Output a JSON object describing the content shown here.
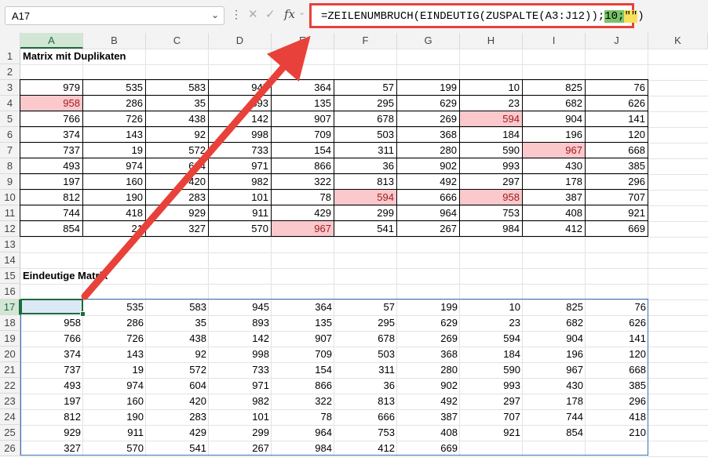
{
  "namebox": {
    "value": "A17"
  },
  "formula": {
    "part1": "=ZEILENUMBRUCH(EINDEUTIG(ZUSPALTE(A3:J12));",
    "part2": "10;",
    "part3": "\"\"",
    "part4": ")"
  },
  "columns": [
    "A",
    "B",
    "C",
    "D",
    "E",
    "F",
    "G",
    "H",
    "I",
    "J",
    "K"
  ],
  "rows": [
    "1",
    "2",
    "3",
    "4",
    "5",
    "6",
    "7",
    "8",
    "9",
    "10",
    "11",
    "12",
    "13",
    "14",
    "15",
    "16",
    "17",
    "18",
    "19",
    "20",
    "21",
    "22",
    "23",
    "24",
    "25",
    "26"
  ],
  "title1": "Matrix mit Duplikaten",
  "title2": "Eindeutige Matrix",
  "matrix1": [
    [
      979,
      535,
      583,
      945,
      364,
      57,
      199,
      10,
      825,
      76
    ],
    [
      958,
      286,
      35,
      893,
      135,
      295,
      629,
      23,
      682,
      626
    ],
    [
      766,
      726,
      438,
      142,
      907,
      678,
      269,
      594,
      904,
      141
    ],
    [
      374,
      143,
      92,
      998,
      709,
      503,
      368,
      184,
      196,
      120
    ],
    [
      737,
      19,
      572,
      733,
      154,
      311,
      280,
      590,
      967,
      668
    ],
    [
      493,
      974,
      604,
      971,
      866,
      36,
      902,
      993,
      430,
      385
    ],
    [
      197,
      160,
      420,
      982,
      322,
      813,
      492,
      297,
      178,
      296
    ],
    [
      812,
      190,
      283,
      101,
      78,
      594,
      666,
      958,
      387,
      707
    ],
    [
      744,
      418,
      929,
      911,
      429,
      299,
      964,
      753,
      408,
      921
    ],
    [
      854,
      21,
      327,
      570,
      967,
      541,
      267,
      984,
      412,
      669
    ]
  ],
  "matrix2": [
    [
      979,
      535,
      583,
      945,
      364,
      57,
      199,
      10,
      825,
      76
    ],
    [
      958,
      286,
      35,
      893,
      135,
      295,
      629,
      23,
      682,
      626
    ],
    [
      766,
      726,
      438,
      142,
      907,
      678,
      269,
      594,
      904,
      141
    ],
    [
      374,
      143,
      92,
      998,
      709,
      503,
      368,
      184,
      196,
      120
    ],
    [
      737,
      19,
      572,
      733,
      154,
      311,
      280,
      590,
      967,
      668
    ],
    [
      493,
      974,
      604,
      971,
      866,
      36,
      902,
      993,
      430,
      385
    ],
    [
      197,
      160,
      420,
      982,
      322,
      813,
      492,
      297,
      178,
      296
    ],
    [
      812,
      190,
      283,
      101,
      78,
      666,
      387,
      707,
      744,
      418
    ],
    [
      929,
      911,
      429,
      299,
      964,
      753,
      408,
      921,
      854,
      210
    ],
    [
      327,
      570,
      541,
      267,
      984,
      412,
      669,
      "",
      "",
      ""
    ]
  ],
  "highlighted_cells": [
    [
      1,
      0
    ],
    [
      2,
      7
    ],
    [
      4,
      8
    ],
    [
      7,
      5
    ],
    [
      7,
      7
    ],
    [
      9,
      4
    ]
  ],
  "colors": {
    "highlight": "#fbc8cc",
    "highlight_text": "#9c1c1c",
    "arrow": "#e8413a",
    "selection": "#1c6b3a"
  },
  "icons": [
    "chevron-down-icon",
    "cancel-icon",
    "confirm-icon",
    "function-icon"
  ]
}
